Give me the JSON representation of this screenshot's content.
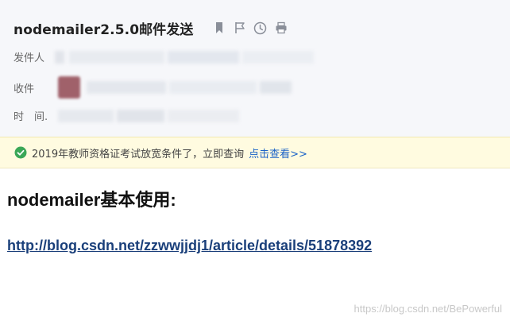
{
  "email": {
    "subject": "nodemailer2.5.0邮件发送",
    "icons": [
      "bookmark-icon",
      "flag-icon",
      "clock-icon",
      "print-icon"
    ],
    "sender_label": "发件人",
    "recipient_label": "收件",
    "time_label": "时　间."
  },
  "notice": {
    "icon": "check-circle-icon",
    "text": "2019年教师资格证考试放宽条件了，立即查询",
    "link_label": "点击查看>>",
    "check_color": "#3aa757",
    "link_color": "#1a62c7"
  },
  "body": {
    "heading": "nodemailer基本使用:",
    "link_text": "http://blog.csdn.net/zzwwjjdj1/article/details/51878392"
  },
  "watermark": {
    "text": "https://blog.csdn.net/BePowerful"
  }
}
